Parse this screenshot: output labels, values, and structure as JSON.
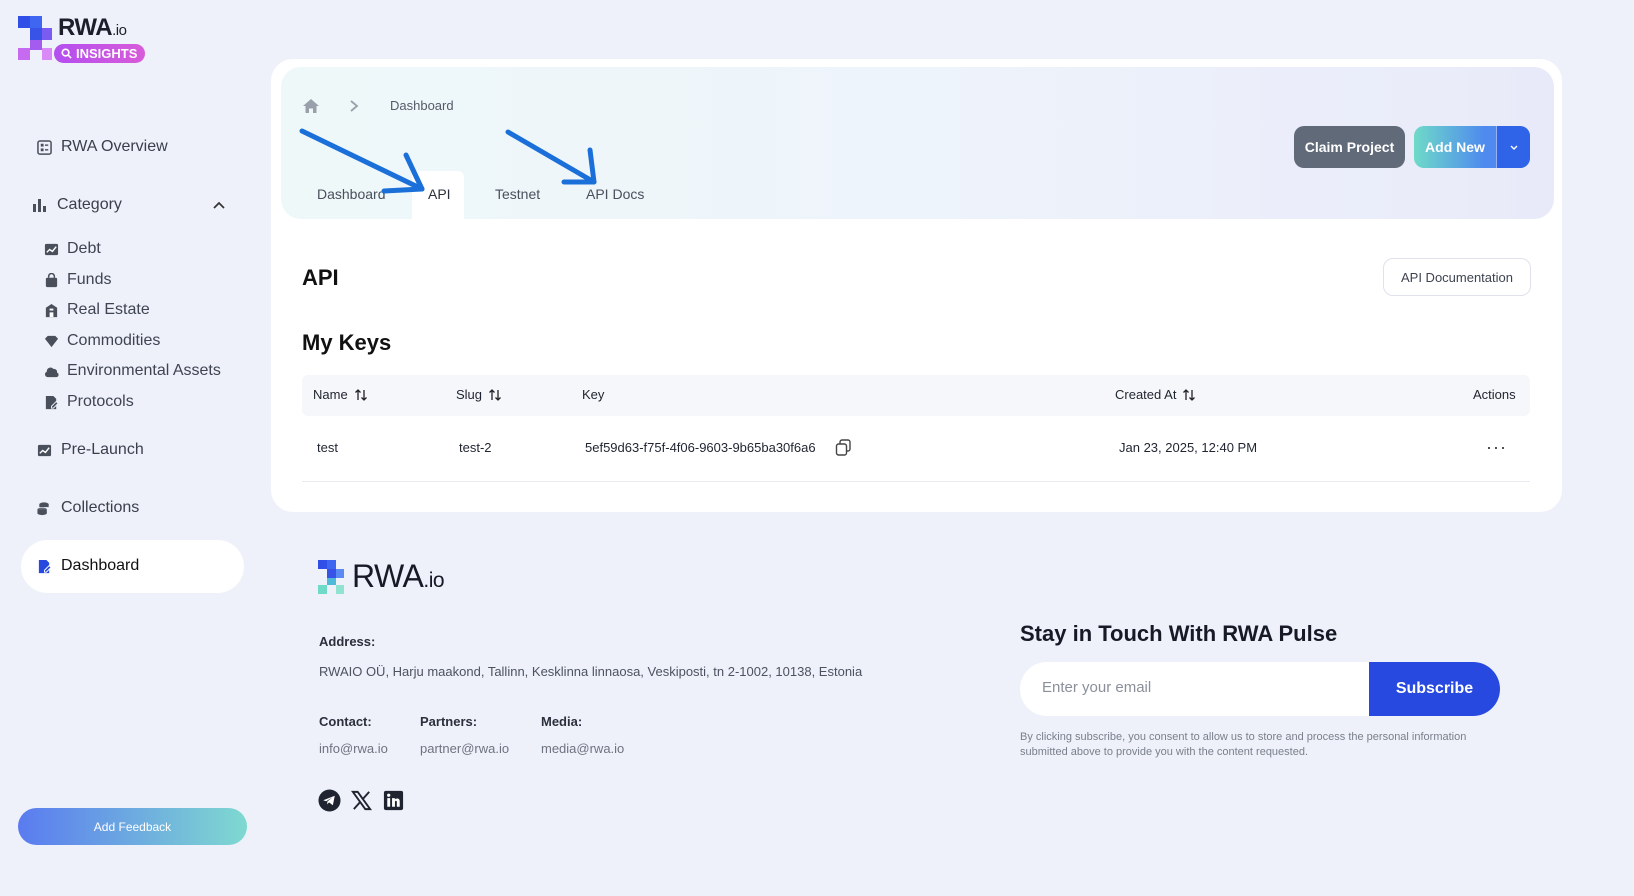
{
  "brand": {
    "name": "RWA",
    "suffix": ".io",
    "badge": "INSIGHTS"
  },
  "sidebar": {
    "items": [
      {
        "label": "RWA Overview",
        "icon": "overview-icon"
      },
      {
        "label": "Category",
        "icon": "bar-chart-icon"
      },
      {
        "label": "Pre-Launch",
        "icon": "trend-icon"
      },
      {
        "label": "Collections",
        "icon": "coins-stack-icon"
      },
      {
        "label": "Dashboard",
        "icon": "dashboard-edit-icon"
      }
    ],
    "category_items": [
      {
        "label": "Debt",
        "icon": "chart-trend-icon"
      },
      {
        "label": "Funds",
        "icon": "bag-icon"
      },
      {
        "label": "Real Estate",
        "icon": "building-icon"
      },
      {
        "label": "Commodities",
        "icon": "gem-icon"
      },
      {
        "label": "Environmental Assets",
        "icon": "cloud-icon"
      },
      {
        "label": "Protocols",
        "icon": "document-icon"
      }
    ],
    "feedback_label": "Add Feedback"
  },
  "breadcrumb": {
    "current": "Dashboard"
  },
  "tabs": [
    "Dashboard",
    "API",
    "Testnet",
    "API Docs"
  ],
  "actions": {
    "claim": "Claim Project",
    "add": "Add New"
  },
  "api": {
    "title": "API",
    "doc_button": "API Documentation",
    "keys_title": "My Keys",
    "columns": [
      "Name",
      "Slug",
      "Key",
      "Created At",
      "Actions"
    ],
    "rows": [
      {
        "name": "test",
        "slug": "test-2",
        "key": "5ef59d63-f75f-4f06-9603-9b65ba30f6a6",
        "created": "Jan 23, 2025, 12:40 PM",
        "actions": "···"
      }
    ]
  },
  "footer": {
    "logo": {
      "name": "RWA",
      "suffix": ".io"
    },
    "address_label": "Address:",
    "address": "RWAIO OÜ, Harju maakond, Tallinn, Kesklinna linnaosa, Veskiposti, tn 2-1002, 10138, Estonia",
    "contact_label": "Contact:",
    "contact": "info@rwa.io",
    "partners_label": "Partners:",
    "partners": "partner@rwa.io",
    "media_label": "Media:",
    "media": "media@rwa.io",
    "newsletter_title": "Stay in Touch With RWA Pulse",
    "email_placeholder": "Enter your email",
    "subscribe": "Subscribe",
    "consent": "By clicking subscribe, you consent to allow us to store and process the personal information submitted above to provide you with the content requested."
  },
  "colors": {
    "accent": "#2749e0",
    "claim_button": "#616a79",
    "annotation_arrow": "#1a6fd9"
  }
}
